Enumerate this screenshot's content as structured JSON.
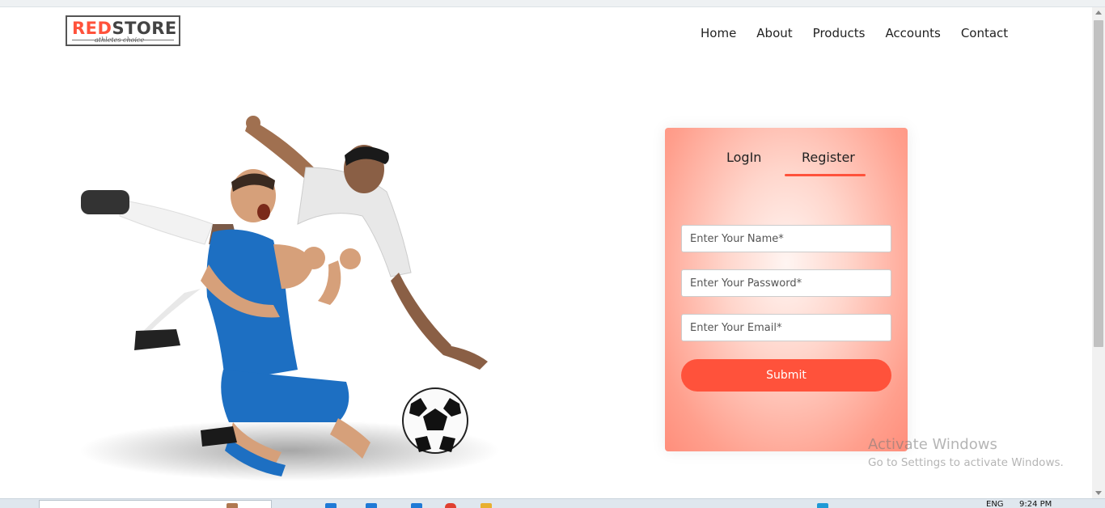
{
  "brand": {
    "name_part1": "RED",
    "name_part2": "STORE",
    "tagline": "athletes choice",
    "accent_color": "#ff523b"
  },
  "nav": {
    "items": [
      {
        "label": "Home"
      },
      {
        "label": "About"
      },
      {
        "label": "Products"
      },
      {
        "label": "Accounts"
      },
      {
        "label": "Contact"
      }
    ]
  },
  "hero": {
    "image": "two-footballers-illustration"
  },
  "form": {
    "tabs": [
      {
        "label": "LogIn",
        "active": false
      },
      {
        "label": "Register",
        "active": true
      }
    ],
    "fields": {
      "name_placeholder": "Enter Your Name*",
      "password_placeholder": "Enter Your Password*",
      "email_placeholder": "Enter Your Email*"
    },
    "submit_label": "Submit"
  },
  "watermark": {
    "line1": "Activate Windows",
    "line2": "Go to Settings to activate Windows."
  },
  "taskbar": {
    "lang": "ENG",
    "time": "9:24 PM"
  },
  "icons": [
    "logo",
    "scroll-up-icon",
    "scroll-down-icon",
    "search-box",
    "taskbar-app-icon"
  ]
}
